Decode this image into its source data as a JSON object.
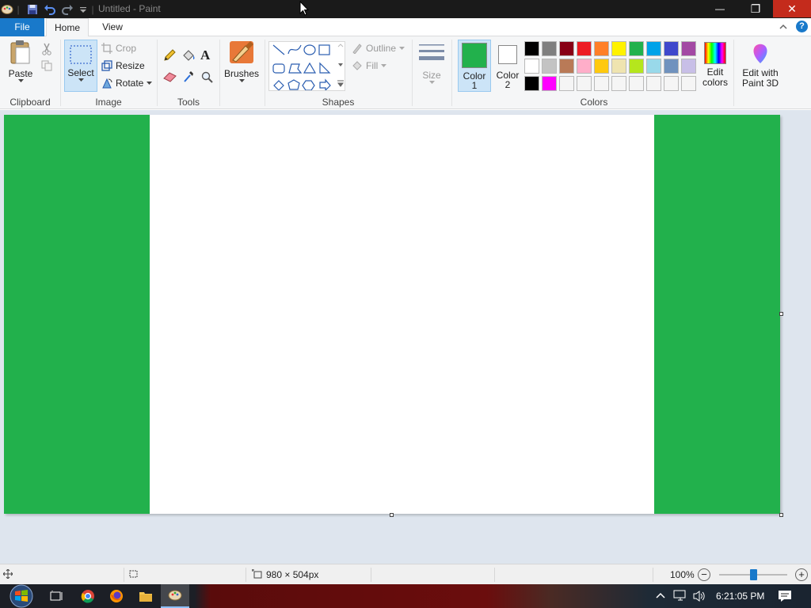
{
  "window": {
    "title": "Untitled - Paint",
    "minimize": "—",
    "maximize": "❐",
    "close": "✕"
  },
  "tabs": {
    "file": "File",
    "home": "Home",
    "view": "View"
  },
  "ribbon": {
    "clipboard": {
      "paste": "Paste",
      "group": "Clipboard"
    },
    "image": {
      "select": "Select",
      "crop": "Crop",
      "resize": "Resize",
      "rotate": "Rotate",
      "group": "Image"
    },
    "tools": {
      "group": "Tools"
    },
    "brushes": {
      "label": "Brushes"
    },
    "shapes": {
      "outline": "Outline",
      "fill": "Fill",
      "group": "Shapes"
    },
    "size": {
      "label": "Size"
    },
    "colors": {
      "color1_line1": "Color",
      "color1_line2": "1",
      "color2_line1": "Color",
      "color2_line2": "2",
      "edit_line1": "Edit",
      "edit_line2": "colors",
      "paint3d_line1": "Edit with",
      "paint3d_line2": "Paint 3D",
      "group": "Colors",
      "color1": "#22b14c",
      "color2": "#ffffff",
      "palette": [
        "#000000",
        "#7f7f7f",
        "#880015",
        "#ed1c24",
        "#ff7f27",
        "#fff200",
        "#22b14c",
        "#00a2e8",
        "#3f48cc",
        "#a349a4",
        "#ffffff",
        "#c3c3c3",
        "#b97a57",
        "#ffaec9",
        "#ffc90e",
        "#efe4b0",
        "#b5e61d",
        "#99d9ea",
        "#7092be",
        "#c8bfe7",
        "#000000",
        "#ff00ff",
        "#f5f5f5",
        "#f5f5f5",
        "#f5f5f5",
        "#f5f5f5",
        "#f5f5f5",
        "#f5f5f5",
        "#f5f5f5",
        "#f5f5f5"
      ]
    }
  },
  "canvas": {
    "left_band_color": "#22b14c",
    "center_color": "#ffffff",
    "right_band_color": "#22b14c"
  },
  "status": {
    "dimensions": "980 × 504px",
    "zoom": "100%",
    "zoom_level": 0.5
  },
  "taskbar": {
    "clock": "6:21:05 PM"
  }
}
